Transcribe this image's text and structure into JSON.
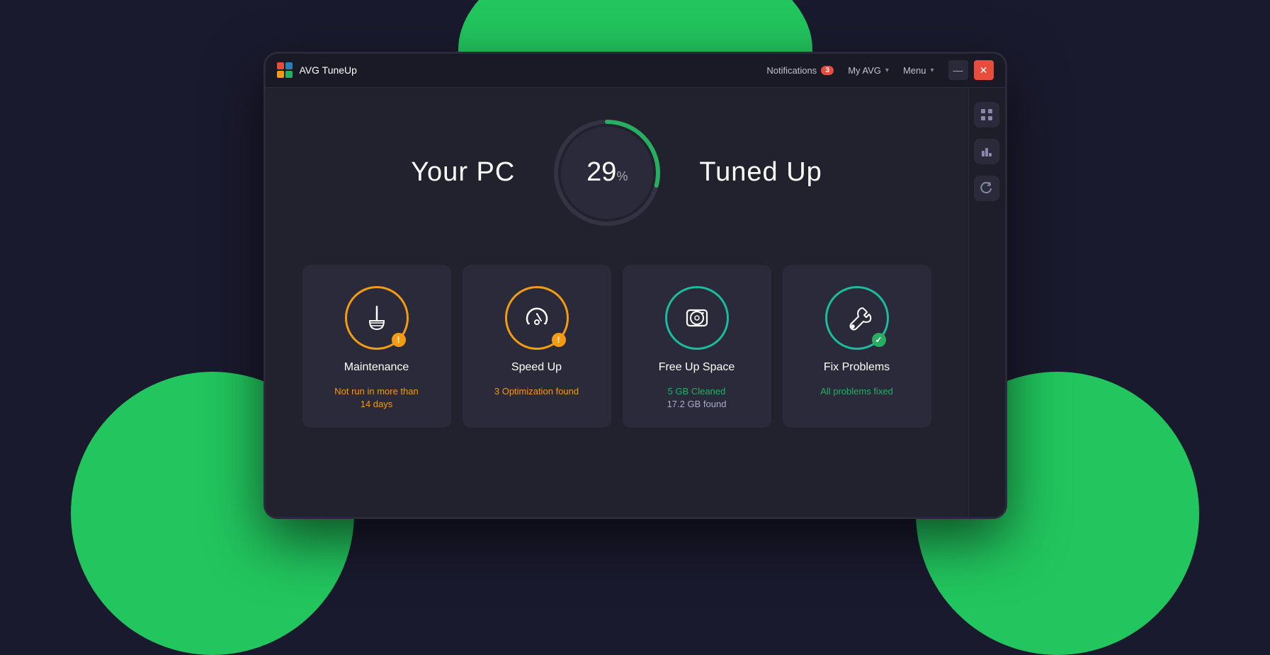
{
  "app": {
    "logo_colors": [
      "#e74c3c",
      "#27ae60",
      "#2980b9",
      "#f39c12"
    ],
    "name": "AVG  TuneUp"
  },
  "titlebar": {
    "notifications_label": "Notifications",
    "notifications_count": "3",
    "my_avg_label": "My AVG",
    "menu_label": "Menu",
    "minimize_symbol": "—",
    "close_symbol": "✕"
  },
  "hero": {
    "text_left": "Your PC",
    "text_right": "Tuned Up",
    "progress_value": "29",
    "progress_unit": "%",
    "progress_max": 100,
    "progress_pct": 29
  },
  "sidebar_icons": [
    {
      "name": "grid-icon",
      "symbol": "⊞"
    },
    {
      "name": "chart-icon",
      "symbol": "▐"
    },
    {
      "name": "refresh-icon",
      "symbol": "↺"
    }
  ],
  "cards": [
    {
      "id": "maintenance",
      "title": "Maintenance",
      "icon_type": "broom",
      "ring_color": "#f39c12",
      "status_dot": "warning",
      "status_line1": "Not run in more than",
      "status_line2": "14 days",
      "status_color": "warning"
    },
    {
      "id": "speed-up",
      "title": "Speed Up",
      "icon_type": "speedometer",
      "ring_color": "#f39c12",
      "status_dot": "warning",
      "status_line1": "3 Optimization found",
      "status_line2": "",
      "status_color": "warning"
    },
    {
      "id": "free-up-space",
      "title": "Free Up Space",
      "icon_type": "disk",
      "ring_color": "#1abc9c",
      "status_dot": "none",
      "status_line1": "5 GB Cleaned",
      "status_line2": "17.2 GB found",
      "status_color1": "success",
      "status_color2": "neutral"
    },
    {
      "id": "fix-problems",
      "title": "Fix Problems",
      "icon_type": "wrench",
      "ring_color": "#1abc9c",
      "status_dot": "success",
      "status_line1": "All problems fixed",
      "status_line2": "",
      "status_color": "success"
    }
  ]
}
